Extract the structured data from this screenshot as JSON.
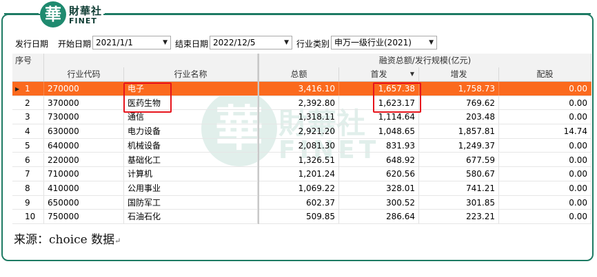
{
  "logo": {
    "badge": "華",
    "cn": "財華社",
    "en": "FINET"
  },
  "filters": {
    "issue_date_label": "发行日期",
    "start_label": "开始日期",
    "start_value": "2021/1/1",
    "end_label": "结束日期",
    "end_value": "2022/12/5",
    "industry_label": "行业类别",
    "industry_value": "申万一级行业(2021)"
  },
  "table": {
    "seq_header": "序号",
    "group_header": "融资总额/发行规模(亿元)",
    "columns": [
      "行业代码",
      "行业名称",
      "总额",
      "首发",
      "增发",
      "配股"
    ],
    "sort_indicator": "▼",
    "rows": [
      {
        "seq": "1",
        "code": "270000",
        "name": "电子",
        "total": "3,416.10",
        "ipo": "1,657.38",
        "seo": "1,758.73",
        "rights": "0.00"
      },
      {
        "seq": "2",
        "code": "370000",
        "name": "医药生物",
        "total": "2,392.80",
        "ipo": "1,623.17",
        "seo": "769.62",
        "rights": "0.00"
      },
      {
        "seq": "3",
        "code": "730000",
        "name": "通信",
        "total": "1,318.11",
        "ipo": "1,114.64",
        "seo": "203.48",
        "rights": "0.00"
      },
      {
        "seq": "4",
        "code": "630000",
        "name": "电力设备",
        "total": "2,921.20",
        "ipo": "1,048.65",
        "seo": "1,857.81",
        "rights": "14.74"
      },
      {
        "seq": "5",
        "code": "640000",
        "name": "机械设备",
        "total": "2,081.30",
        "ipo": "831.93",
        "seo": "1,249.37",
        "rights": "0.00"
      },
      {
        "seq": "6",
        "code": "220000",
        "name": "基础化工",
        "total": "1,326.51",
        "ipo": "648.92",
        "seo": "677.59",
        "rights": "0.00"
      },
      {
        "seq": "7",
        "code": "710000",
        "name": "计算机",
        "total": "1,201.24",
        "ipo": "620.56",
        "seo": "580.67",
        "rights": "0.00"
      },
      {
        "seq": "8",
        "code": "410000",
        "name": "公用事业",
        "total": "1,069.22",
        "ipo": "328.01",
        "seo": "741.21",
        "rights": "0.00"
      },
      {
        "seq": "9",
        "code": "650000",
        "name": "国防军工",
        "total": "602.37",
        "ipo": "300.52",
        "seo": "301.85",
        "rights": "0.00"
      },
      {
        "seq": "10",
        "code": "750000",
        "name": "石油石化",
        "total": "509.85",
        "ipo": "286.64",
        "seo": "223.21",
        "rights": "0.00"
      }
    ],
    "selected_row": 0
  },
  "watermark": {
    "badge": "華",
    "cn": "財華社",
    "en": "FINET"
  },
  "source_text": "来源：choice 数据",
  "source_mark": "↵",
  "colors": {
    "accent": "#1d7a63",
    "selected_row": "#fb6a1e",
    "highlight_box": "#e6141c"
  }
}
